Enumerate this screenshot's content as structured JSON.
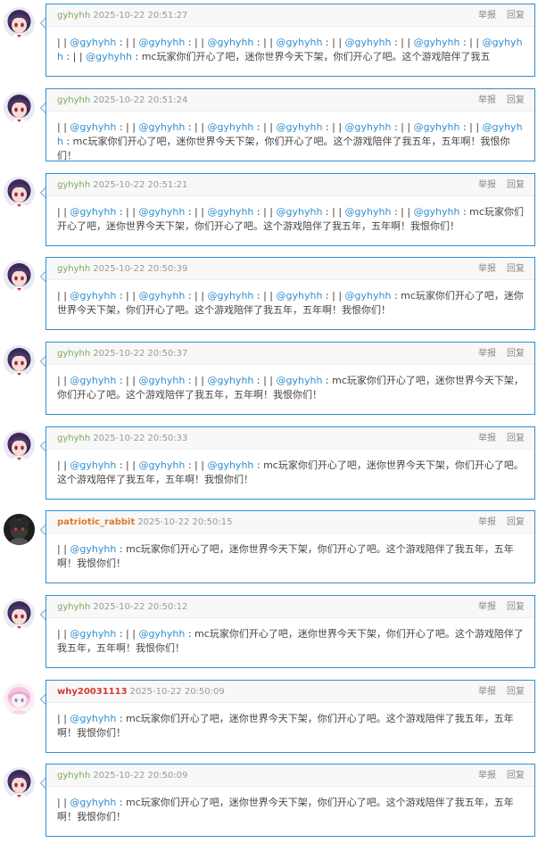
{
  "actions": {
    "report": "举报",
    "reply": "回复"
  },
  "colors": {
    "border": "#2f8fd0",
    "mention": "#2f8fd0",
    "user_green": "#7aa95c",
    "user_red": "#d23b2e",
    "user_orange": "#e0772a"
  },
  "comments": [
    {
      "user": "gyhyhh",
      "user_style": "green",
      "avatar": "anime-purple-hair-avatar",
      "time": "2025-10-22 20:51:27",
      "segments": [
        {
          "t": "| | "
        },
        {
          "m": "@gyhyhh"
        },
        {
          "t": " : | | "
        },
        {
          "m": "@gyhyhh"
        },
        {
          "t": " : | | "
        },
        {
          "m": "@gyhyhh"
        },
        {
          "t": " : | | "
        },
        {
          "m": "@gyhyhh"
        },
        {
          "t": " : | | "
        },
        {
          "m": "@gyhyhh"
        },
        {
          "t": " : | | "
        },
        {
          "m": "@gyhyhh"
        },
        {
          "t": " : | | "
        },
        {
          "m": "@gyhyhh"
        },
        {
          "t": " : | | "
        },
        {
          "m": "@gyhyhh"
        },
        {
          "t": " : mc玩家你们开心了吧，迷你世界今天下架，你们开心了吧。这个游戏陪伴了我五"
        }
      ]
    },
    {
      "user": "gyhyhh",
      "user_style": "green",
      "avatar": "anime-purple-hair-avatar",
      "time": "2025-10-22 20:51:24",
      "segments": [
        {
          "t": "| | "
        },
        {
          "m": "@gyhyhh"
        },
        {
          "t": " : | | "
        },
        {
          "m": "@gyhyhh"
        },
        {
          "t": " : | | "
        },
        {
          "m": "@gyhyhh"
        },
        {
          "t": " : | | "
        },
        {
          "m": "@gyhyhh"
        },
        {
          "t": " : | | "
        },
        {
          "m": "@gyhyhh"
        },
        {
          "t": " : | | "
        },
        {
          "m": "@gyhyhh"
        },
        {
          "t": " : | | "
        },
        {
          "m": "@gyhyhh"
        },
        {
          "t": " : mc玩家你们开心了吧，迷你世界今天下架，你们开心了吧。这个游戏陪伴了我五年，五年啊！我恨你们！"
        }
      ]
    },
    {
      "user": "gyhyhh",
      "user_style": "green",
      "avatar": "anime-purple-hair-avatar",
      "time": "2025-10-22 20:51:21",
      "segments": [
        {
          "t": "| | "
        },
        {
          "m": "@gyhyhh"
        },
        {
          "t": " : | | "
        },
        {
          "m": "@gyhyhh"
        },
        {
          "t": " : | | "
        },
        {
          "m": "@gyhyhh"
        },
        {
          "t": " : | | "
        },
        {
          "m": "@gyhyhh"
        },
        {
          "t": " : | | "
        },
        {
          "m": "@gyhyhh"
        },
        {
          "t": " : | | "
        },
        {
          "m": "@gyhyhh"
        },
        {
          "t": " : mc玩家你们开心了吧，迷你世界今天下架，你们开心了吧。这个游戏陪伴了我五年，五年啊！我恨你们！"
        }
      ]
    },
    {
      "user": "gyhyhh",
      "user_style": "green",
      "avatar": "anime-purple-hair-avatar",
      "time": "2025-10-22 20:50:39",
      "segments": [
        {
          "t": "| | "
        },
        {
          "m": "@gyhyhh"
        },
        {
          "t": " : | | "
        },
        {
          "m": "@gyhyhh"
        },
        {
          "t": " : | | "
        },
        {
          "m": "@gyhyhh"
        },
        {
          "t": " : | | "
        },
        {
          "m": "@gyhyhh"
        },
        {
          "t": " : | | "
        },
        {
          "m": "@gyhyhh"
        },
        {
          "t": " : mc玩家你们开心了吧，迷你世界今天下架，你们开心了吧。这个游戏陪伴了我五年，五年啊！我恨你们！"
        }
      ]
    },
    {
      "user": "gyhyhh",
      "user_style": "green",
      "avatar": "anime-purple-hair-avatar",
      "time": "2025-10-22 20:50:37",
      "segments": [
        {
          "t": "| | "
        },
        {
          "m": "@gyhyhh"
        },
        {
          "t": " : | | "
        },
        {
          "m": "@gyhyhh"
        },
        {
          "t": " : | | "
        },
        {
          "m": "@gyhyhh"
        },
        {
          "t": " : | | "
        },
        {
          "m": "@gyhyhh"
        },
        {
          "t": " : mc玩家你们开心了吧，迷你世界今天下架，你们开心了吧。这个游戏陪伴了我五年，五年啊！我恨你们！"
        }
      ]
    },
    {
      "user": "gyhyhh",
      "user_style": "green",
      "avatar": "anime-purple-hair-avatar",
      "time": "2025-10-22 20:50:33",
      "segments": [
        {
          "t": "| | "
        },
        {
          "m": "@gyhyhh"
        },
        {
          "t": " : | | "
        },
        {
          "m": "@gyhyhh"
        },
        {
          "t": " : | | "
        },
        {
          "m": "@gyhyhh"
        },
        {
          "t": " : mc玩家你们开心了吧，迷你世界今天下架，你们开心了吧。这个游戏陪伴了我五年，五年啊！我恨你们！"
        }
      ]
    },
    {
      "user": "patriotic_rabbit",
      "user_style": "orange",
      "avatar": "dark-character-avatar",
      "time": "2025-10-22 20:50:15",
      "segments": [
        {
          "t": "| | "
        },
        {
          "m": "@gyhyhh"
        },
        {
          "t": " : mc玩家你们开心了吧，迷你世界今天下架，你们开心了吧。这个游戏陪伴了我五年，五年啊！我恨你们！"
        }
      ]
    },
    {
      "user": "gyhyhh",
      "user_style": "green",
      "avatar": "anime-purple-hair-avatar",
      "time": "2025-10-22 20:50:12",
      "segments": [
        {
          "t": "| | "
        },
        {
          "m": "@gyhyhh"
        },
        {
          "t": " : | | "
        },
        {
          "m": "@gyhyhh"
        },
        {
          "t": " : mc玩家你们开心了吧，迷你世界今天下架，你们开心了吧。这个游戏陪伴了我五年，五年啊！我恨你们！"
        }
      ]
    },
    {
      "user": "why20031113",
      "user_style": "red",
      "avatar": "pink-anime-avatar",
      "time": "2025-10-22 20:50:09",
      "segments": [
        {
          "t": "| | "
        },
        {
          "m": "@gyhyhh"
        },
        {
          "t": " : mc玩家你们开心了吧，迷你世界今天下架，你们开心了吧。这个游戏陪伴了我五年，五年啊！我恨你们！"
        }
      ]
    },
    {
      "user": "gyhyhh",
      "user_style": "green",
      "avatar": "anime-purple-hair-avatar",
      "time": "2025-10-22 20:50:09",
      "segments": [
        {
          "t": "| | "
        },
        {
          "m": "@gyhyhh"
        },
        {
          "t": " : mc玩家你们开心了吧，迷你世界今天下架，你们开心了吧。这个游戏陪伴了我五年，五年啊！我恨你们！"
        }
      ]
    }
  ]
}
